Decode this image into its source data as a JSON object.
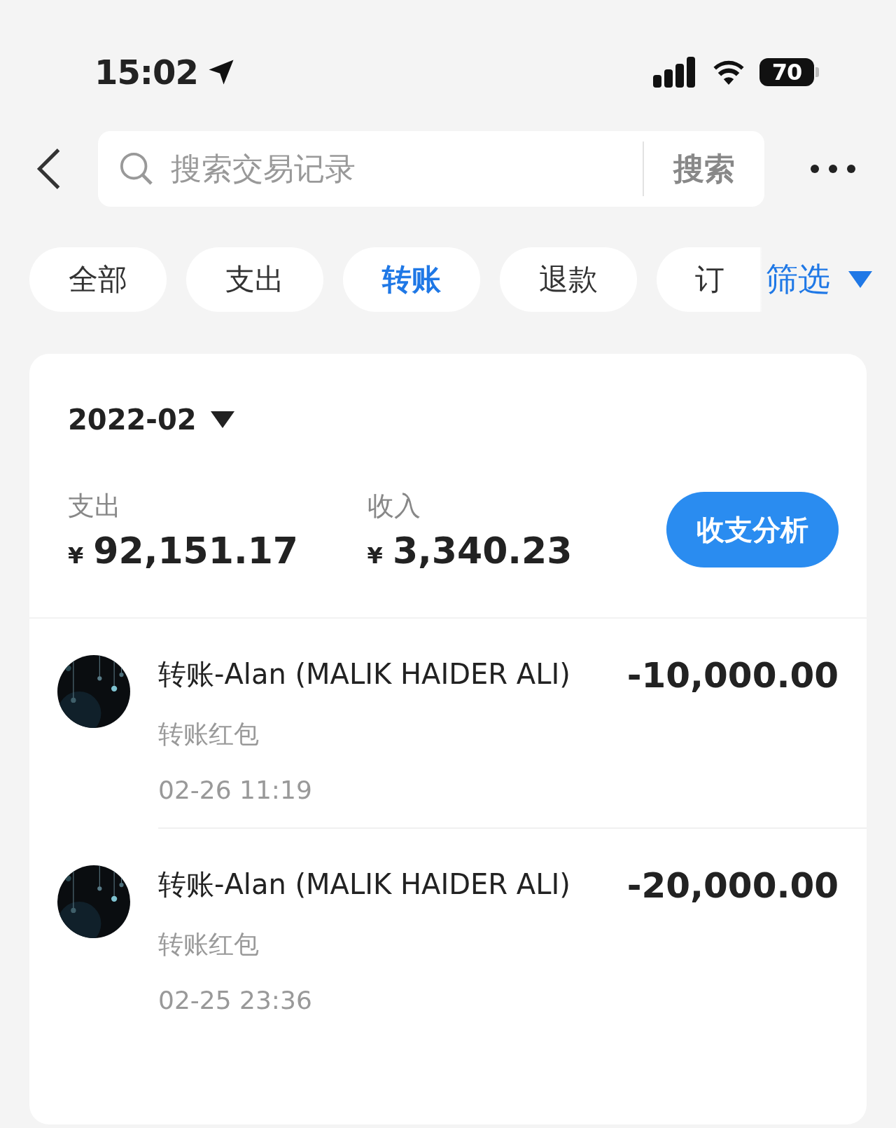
{
  "status_bar": {
    "time": "15:02",
    "battery": "70"
  },
  "search": {
    "placeholder": "搜索交易记录",
    "button": "搜索"
  },
  "tabs": [
    {
      "label": "全部",
      "selected": false
    },
    {
      "label": "支出",
      "selected": false
    },
    {
      "label": "转账",
      "selected": true
    },
    {
      "label": "退款",
      "selected": false
    },
    {
      "label": "订",
      "selected": false
    }
  ],
  "filter": "筛选",
  "month": "2022-02",
  "summary": [
    {
      "label": "支出",
      "currency": "¥",
      "amount": "92,151.17"
    },
    {
      "label": "收入",
      "currency": "¥",
      "amount": "3,340.23"
    }
  ],
  "analysis_button": "收支分析",
  "transactions": [
    {
      "title": "转账-Alan (MALIK HAIDER ALI)",
      "subtitle": "转账红包",
      "time": "02-26 11:19",
      "amount": "-10,000.00"
    },
    {
      "title": "转账-Alan (MALIK HAIDER ALI)",
      "subtitle": "转账红包",
      "time": "02-25 23:36",
      "amount": "-20,000.00"
    }
  ]
}
